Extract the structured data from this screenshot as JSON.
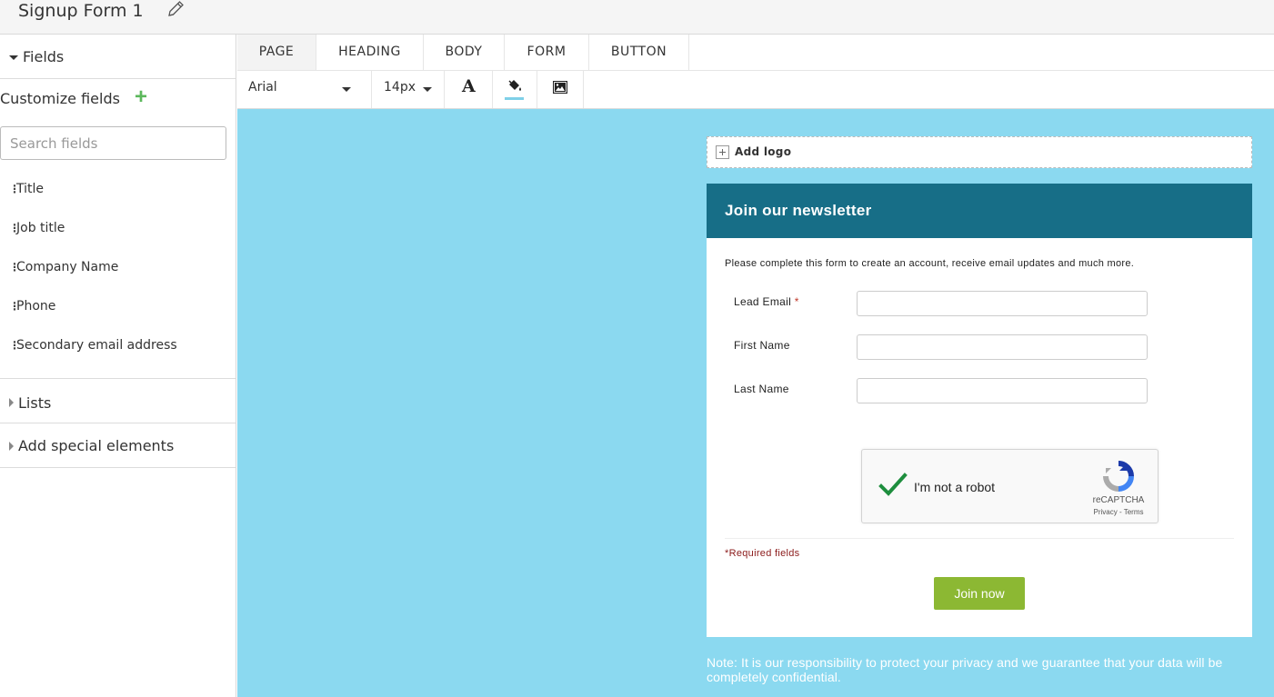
{
  "header": {
    "title": "Signup Form 1"
  },
  "sidebar": {
    "fields_section": "Fields",
    "customize_label": "Customize fields",
    "search_placeholder": "Search fields",
    "fields": [
      "Title",
      "Job title",
      "Company Name",
      "Phone",
      "Secondary email address"
    ],
    "lists_section": "Lists",
    "special_section": "Add special elements"
  },
  "tabs": [
    "PAGE",
    "HEADING",
    "BODY",
    "FORM",
    "BUTTON"
  ],
  "toolbar": {
    "font": "Arial",
    "size": "14px",
    "text_glyph": "A"
  },
  "canvas": {
    "background": "#8bd9f0",
    "logo_label": "Add logo",
    "heading": "Join our newsletter",
    "heading_color": "#176e87",
    "intro": "Please complete this form to create an account, receive email updates and much more.",
    "form_fields": [
      {
        "label": "Lead Email",
        "required_mark": "*"
      },
      {
        "label": "First Name",
        "required_mark": ""
      },
      {
        "label": "Last Name",
        "required_mark": ""
      }
    ],
    "captcha": {
      "text": "I'm not a robot",
      "brand": "reCAPTCHA",
      "links": "Privacy - Terms"
    },
    "required_note": "*Required fields",
    "submit_label": "Join now",
    "submit_color": "#8cb833",
    "privacy_note": "Note: It is our responsibility to protect your privacy and we guarantee that your data will be completely confidential."
  }
}
